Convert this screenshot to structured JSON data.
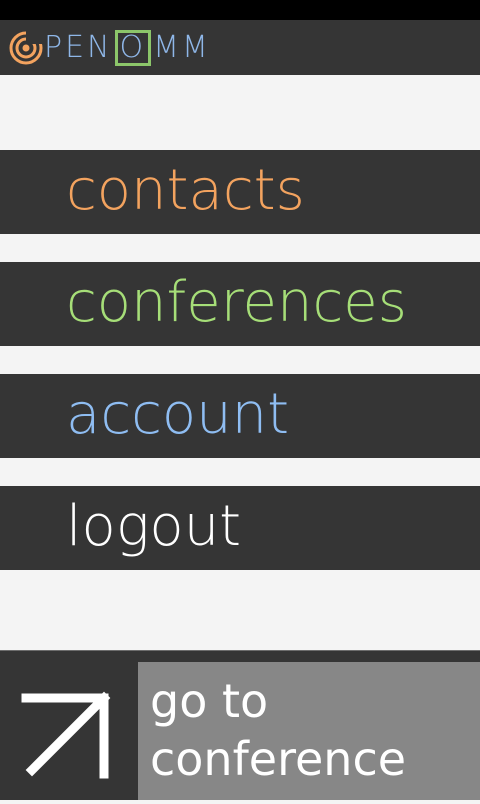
{
  "app": {
    "logo_text_1": "PEN",
    "logo_text_boxed": "O",
    "logo_text_2": "MM"
  },
  "menu": {
    "items": [
      {
        "label": "contacts",
        "color": "#f3a35f"
      },
      {
        "label": "conferences",
        "color": "#a6de78"
      },
      {
        "label": "account",
        "color": "#8fbdf2"
      },
      {
        "label": "logout",
        "color": "#ffffff"
      }
    ]
  },
  "bottom": {
    "goto_line1": "go to",
    "goto_line2": "conference",
    "icon": "arrow-up-right-icon"
  }
}
